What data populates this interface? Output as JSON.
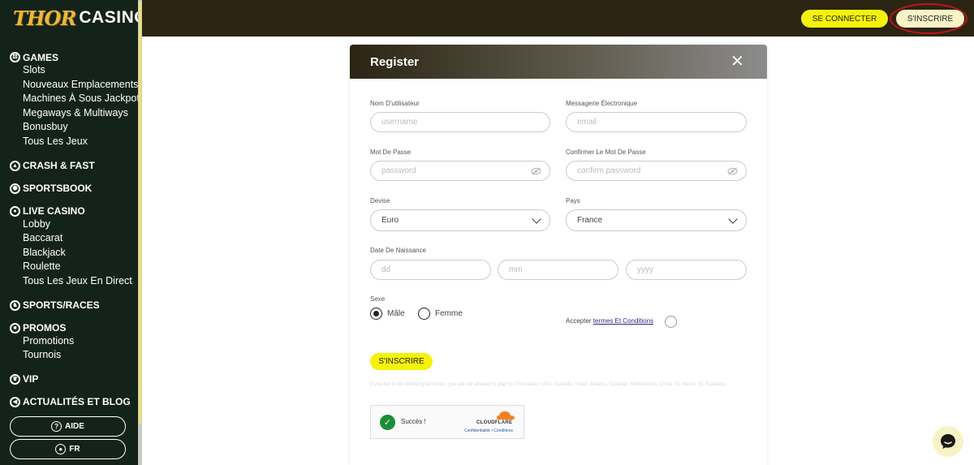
{
  "brand": {
    "logo_thor": "THOR",
    "logo_casino": "CASINO"
  },
  "sidebar": {
    "sections": [
      {
        "label": "GAMES",
        "icon": "dice-icon",
        "items": [
          "Slots",
          "Nouveaux Emplacements",
          "Machines À Sous Jackpot",
          "Megaways & Multiways",
          "Bonusbuy",
          "Tous Les Jeux"
        ]
      },
      {
        "label": "CRASH & FAST",
        "icon": "rocket-icon",
        "items": []
      },
      {
        "label": "SPORTSBOOK",
        "icon": "soccer-ball-icon",
        "items": []
      },
      {
        "label": "LIVE CASINO",
        "icon": "live-icon",
        "items": [
          "Lobby",
          "Baccarat",
          "Blackjack",
          "Roulette",
          "Tous Les Jeux En Direct"
        ]
      },
      {
        "label": "SPORTS/RACES",
        "icon": "horse-icon",
        "items": []
      },
      {
        "label": "PROMOS",
        "icon": "gift-icon",
        "items": [
          "Promotions",
          "Tournois"
        ]
      },
      {
        "label": "VIP",
        "icon": "crown-icon",
        "items": []
      },
      {
        "label": "ACTUALITÉS ET BLOG",
        "icon": "megaphone-icon",
        "items": []
      }
    ],
    "help_label": "AIDE",
    "lang_label": "FR"
  },
  "header": {
    "login_label": "SE CONNECTER",
    "signup_label": "S'INSCRIRE"
  },
  "modal": {
    "title": "Register",
    "username_label": "Nom D'utilisateur",
    "username_placeholder": "username",
    "email_label": "Messagerie Électronique",
    "email_placeholder": "email",
    "password_label": "Mot De Passe",
    "password_placeholder": "password",
    "confirm_label": "Confirmer Le Mot De Passe",
    "confirm_placeholder": "confirm password",
    "currency_label": "Devise",
    "currency_value": "Euro",
    "country_label": "Pays",
    "country_value": "France",
    "dob_label": "Date De Naissance",
    "dob_day": "dd",
    "dob_month": "mm",
    "dob_year": "yyyy",
    "sex_label": "Sexe",
    "male_label": "Mâle",
    "female_label": "Femme",
    "selected_sex": "Mâle",
    "accept_prefix": "Accepter",
    "accept_link": "termes Et Conditions",
    "submit_label": "S'INSCRIRE",
    "notice": "If you live in the following territories, you are not allowed to play on Thorcasino: USA, Australia, Israel, Belarus, Curacao, Netherlands, China, St. Martin, St. Eustatius.",
    "captcha_status": "Succès !",
    "captcha_brand": "CLOUDFLARE",
    "captcha_privacy": "Confidentialité",
    "captcha_sep": "•",
    "captcha_terms": "Conditions"
  },
  "colors": {
    "accent_yellow": "#f5f20a",
    "sidebar_bg": "#14231a",
    "topbar_bg": "#2c2412",
    "highlight_red": "#c0141c"
  }
}
